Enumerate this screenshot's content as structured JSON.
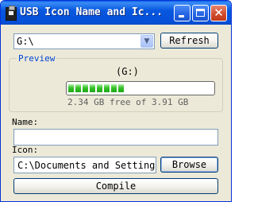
{
  "window": {
    "title": "USB Icon Name and Ic...",
    "min_icon": "minimize-icon",
    "max_icon": "maximize-icon",
    "close_icon": "close-icon",
    "close_glyph": "✕"
  },
  "drive": {
    "selected": "G:\\",
    "refresh_label": "Refresh",
    "arrow_glyph": "▼"
  },
  "preview": {
    "label": "Preview",
    "drive_label": "(G:)",
    "used_fraction": 0.4,
    "free_text": "2.34 GB free of 3.91 GB",
    "bar_color": "#20a71a"
  },
  "name": {
    "label": "Name:",
    "value": ""
  },
  "icon": {
    "label": "Icon:",
    "value": "C:\\Documents and Settings\\Adm",
    "browse_label": "Browse"
  },
  "compile_label": "Compile"
}
